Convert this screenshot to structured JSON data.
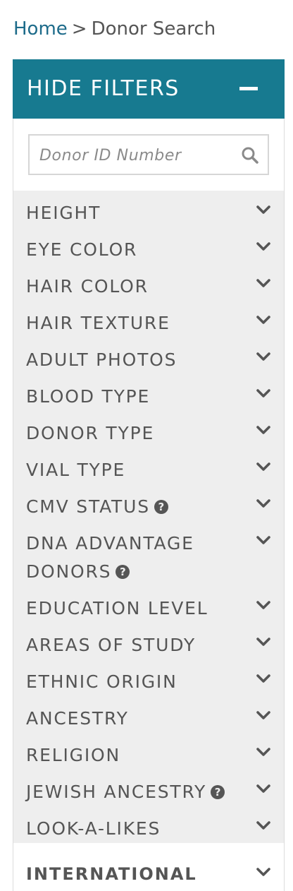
{
  "breadcrumb": {
    "home": "Home",
    "separator": ">",
    "current": "Donor Search"
  },
  "filters_header": {
    "label": "HIDE FILTERS",
    "icon": "minus-icon"
  },
  "search": {
    "placeholder": "Donor ID Number",
    "value": "",
    "icon": "search-icon"
  },
  "filters": [
    {
      "label": "HEIGHT",
      "help": false
    },
    {
      "label": "EYE COLOR",
      "help": false
    },
    {
      "label": "HAIR COLOR",
      "help": false
    },
    {
      "label": "HAIR TEXTURE",
      "help": false
    },
    {
      "label": "ADULT PHOTOS",
      "help": false
    },
    {
      "label": "BLOOD TYPE",
      "help": false
    },
    {
      "label": "DONOR TYPE",
      "help": false
    },
    {
      "label": "VIAL TYPE",
      "help": false
    },
    {
      "label": "CMV STATUS",
      "help": true
    },
    {
      "label": "DNA ADVANTAGE DONORS",
      "help": true
    },
    {
      "label": "EDUCATION LEVEL",
      "help": false
    },
    {
      "label": "AREAS OF STUDY",
      "help": false
    },
    {
      "label": "ETHNIC ORIGIN",
      "help": false
    },
    {
      "label": "ANCESTRY",
      "help": false
    },
    {
      "label": "RELIGION",
      "help": false
    },
    {
      "label": "JEWISH ANCESTRY",
      "help": true
    },
    {
      "label": "LOOK-A-LIKES",
      "help": false
    }
  ],
  "help_glyph": "?",
  "international": {
    "label": "INTERNATIONAL"
  },
  "colors": {
    "header_bg": "#177a90",
    "link": "#1d6b8a",
    "list_bg": "#eeeeee",
    "text": "#555555"
  }
}
